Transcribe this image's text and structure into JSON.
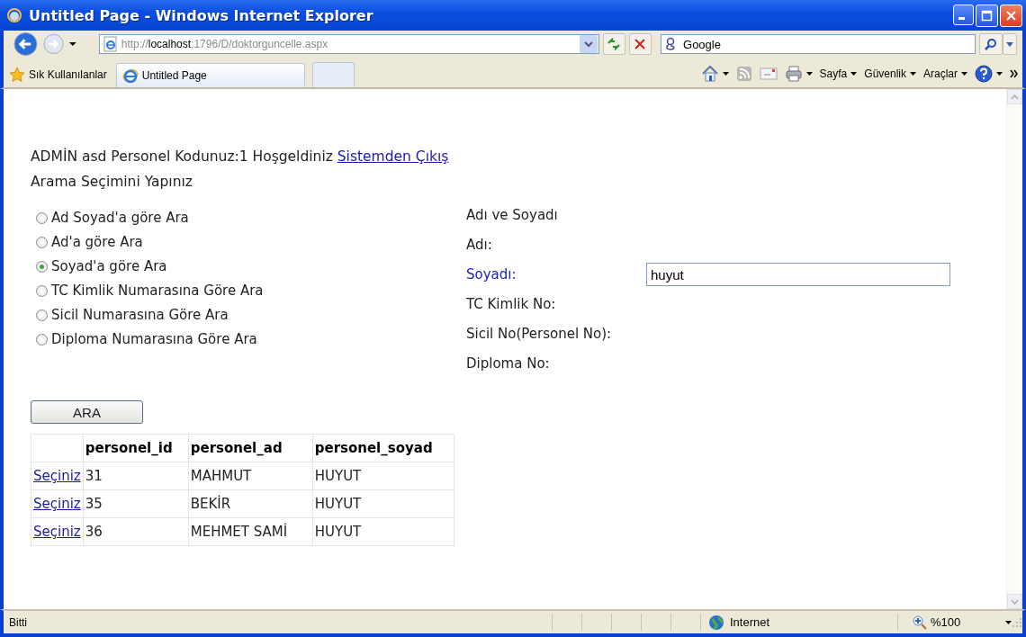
{
  "window": {
    "title": "Untitled Page - Windows Internet Explorer"
  },
  "address_bar": {
    "url": "http://**localhost**:1796/D/doktorguncelle.aspx"
  },
  "search": {
    "placeholder": "Google"
  },
  "favorites": {
    "label": "Sık Kullanılanlar"
  },
  "tabs": [
    {
      "label": "Untitled Page",
      "selected": true
    }
  ],
  "command_bar": {
    "menus": [
      "Sayfa",
      "Güvenlik",
      "Araçlar"
    ]
  },
  "page": {
    "welcome": "ADMİN asd Personel Kodunuz:1 Hoşgeldiniz",
    "logout_link": "Sistemden Çıkış",
    "search_prompt": "Arama Seçimini Yapınız",
    "search_options": [
      {
        "label": "Ad Soyad'a göre Ara",
        "selected": false
      },
      {
        "label": "Ad'a göre Ara",
        "selected": false
      },
      {
        "label": "Soyad'a göre Ara",
        "selected": true
      },
      {
        "label": "TC Kimlik Numarasına Göre Ara",
        "selected": false
      },
      {
        "label": "Sicil Numarasına Göre Ara",
        "selected": false
      },
      {
        "label": "Diploma Numarasına Göre Ara",
        "selected": false
      }
    ],
    "fields": [
      {
        "label": "Adı ve Soyadı",
        "active": false
      },
      {
        "label": "Adı:",
        "active": false
      },
      {
        "label": "Soyadı:",
        "active": true,
        "value": "huyut"
      },
      {
        "label": "TC Kimlik No:",
        "active": false
      },
      {
        "label": "Sicil No(Personel No):",
        "active": false
      },
      {
        "label": "Diploma No:",
        "active": false
      }
    ],
    "search_button": "ARA",
    "table": {
      "columns": [
        "personel_id",
        "personel_ad",
        "personel_soyad"
      ],
      "rows": [
        {
          "link": "Seçiniz",
          "cells": [
            "31",
            "MAHMUT",
            "HUYUT"
          ]
        },
        {
          "link": "Seçiniz",
          "cells": [
            "35",
            "BEKİR",
            "HUYUT"
          ]
        },
        {
          "link": "Seçiniz",
          "cells": [
            "36",
            "MEHMET SAMİ",
            "HUYUT"
          ]
        }
      ]
    }
  },
  "status_bar": {
    "text": "Bitti",
    "zone": "Internet",
    "zoom": "%100"
  }
}
